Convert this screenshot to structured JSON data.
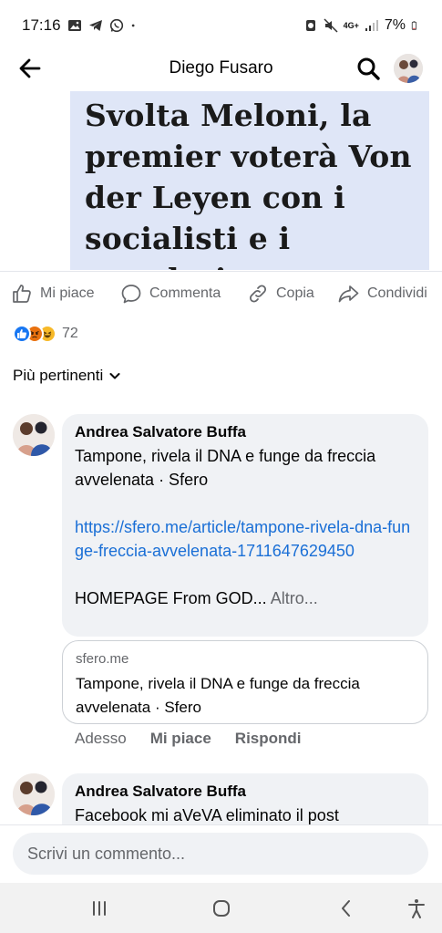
{
  "status": {
    "time": "17:16",
    "left_icons": [
      "gallery-icon",
      "telegram-icon",
      "whatsapp-icon",
      "dot-icon"
    ],
    "right_icons": [
      "alarm-icon",
      "mute-icon",
      "network-icon",
      "signal-icon",
      "battery-icon"
    ],
    "network": "4G+",
    "battery": "7%"
  },
  "header": {
    "title": "Diego Fusaro",
    "back_icon": "arrow-left-icon",
    "search_icon": "search-icon"
  },
  "post": {
    "headline": "Svolta Meloni, la premier voterà Von der Leyen con i socialisti e i popolari"
  },
  "actions": {
    "like": "Mi piace",
    "comment": "Commenta",
    "copy": "Copia",
    "share": "Condividi"
  },
  "reactions": {
    "count": "72",
    "types": [
      "like",
      "angry",
      "haha"
    ]
  },
  "sort": {
    "label": "Più pertinenti"
  },
  "comments": [
    {
      "author": "Andrea Salvatore Buffa",
      "text": "Tampone, rivela il DNA e funge da freccia avvelenata · Sfero",
      "link": "https://sfero.me/article/tampone-rivela-dna-funge-freccia-avvelenata-1711647629450",
      "tail": "HOMEPAGE From GOD...",
      "more": "Altro...",
      "preview": {
        "domain": "sfero.me",
        "title": "Tampone, rivela il DNA e funge da freccia avvelenata · Sfero"
      },
      "time": "Adesso",
      "like": "Mi piace",
      "reply": "Rispondi"
    },
    {
      "author": "Andrea Salvatore Buffa",
      "text": "Facebook mi aVeVA eliminato il post"
    }
  ],
  "composer": {
    "placeholder": "Scrivi un commento..."
  },
  "colors": {
    "link": "#1a6fd6",
    "secondary_text": "#65676b",
    "bubble_bg": "#f0f2f5",
    "image_bg": "#dfe6f7"
  }
}
